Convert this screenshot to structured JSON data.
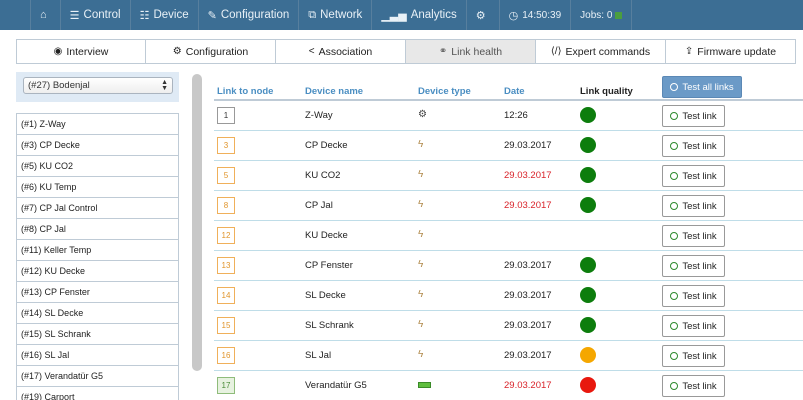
{
  "nav": {
    "items": [
      {
        "name": "nav-home",
        "icon": "home-icon",
        "glyph": "⌂",
        "label": ""
      },
      {
        "name": "nav-control",
        "icon": "sliders-icon",
        "glyph": "☰",
        "label": "Control"
      },
      {
        "name": "nav-device",
        "icon": "database-icon",
        "glyph": "☷",
        "label": "Device"
      },
      {
        "name": "nav-configuration",
        "icon": "wrench-icon",
        "glyph": "✎",
        "label": "Configuration"
      },
      {
        "name": "nav-network",
        "icon": "network-icon",
        "glyph": "⧉",
        "label": "Network"
      },
      {
        "name": "nav-analytics",
        "icon": "signal-icon",
        "glyph": "▁▃▅",
        "label": "Analytics"
      },
      {
        "name": "nav-settings",
        "icon": "gear-icon",
        "glyph": "⚙",
        "label": ""
      }
    ],
    "time": "14:50:39",
    "jobs_label": "Jobs: 0"
  },
  "tabs": [
    {
      "label": "Interview",
      "icon": "comment-icon",
      "glyph": "◉"
    },
    {
      "label": "Configuration",
      "icon": "gears-icon",
      "glyph": "⚙"
    },
    {
      "label": "Association",
      "icon": "share-icon",
      "glyph": "<"
    },
    {
      "label": "Link health",
      "icon": "link-icon",
      "glyph": "⚭"
    },
    {
      "label": "Expert commands",
      "icon": "code-icon",
      "glyph": "⟨/⟩"
    },
    {
      "label": "Firmware update",
      "icon": "upload-icon",
      "glyph": "⇪"
    }
  ],
  "active_tab": "Link health",
  "device_select": {
    "value": "(#27) Bodenjal"
  },
  "device_list": [
    "(#1) Z-Way",
    "(#3) CP Decke",
    "(#5) KU CO2",
    "(#6) KU Temp",
    "(#7) CP Jal Control",
    "(#8) CP Jal",
    "(#11) Keller Temp",
    "(#12) KU Decke",
    "(#13) CP Fenster",
    "(#14) SL Decke",
    "(#15) SL Schrank",
    "(#16) SL Jal",
    "(#17) Verandatür G5",
    "(#19) Carport"
  ],
  "table": {
    "headers": {
      "link": "Link to node",
      "name": "Device name",
      "type": "Device type",
      "date": "Date",
      "quality": "Link quality"
    },
    "test_all_label": "Test all links",
    "test_link_label": "Test link",
    "colors": {
      "green": "#0d7d0d",
      "orange": "#f5a700",
      "red": "#e8180e"
    },
    "rows": [
      {
        "node": "1",
        "node_style": "plain",
        "name": "Z-Way",
        "type": "gear-icon",
        "type_glyph": "⚙",
        "date": "12:26",
        "date_red": false,
        "quality": "green"
      },
      {
        "node": "3",
        "node_style": "orange",
        "name": "CP Decke",
        "type": "bolt-icon",
        "type_glyph": "ϟ",
        "date": "29.03.2017",
        "date_red": false,
        "quality": "green"
      },
      {
        "node": "5",
        "node_style": "orange",
        "name": "KU CO2",
        "type": "bolt-icon",
        "type_glyph": "ϟ",
        "date": "29.03.2017",
        "date_red": true,
        "quality": "green"
      },
      {
        "node": "8",
        "node_style": "orange",
        "name": "CP Jal",
        "type": "bolt-icon",
        "type_glyph": "ϟ",
        "date": "29.03.2017",
        "date_red": true,
        "quality": "green"
      },
      {
        "node": "12",
        "node_style": "orange",
        "name": "KU Decke",
        "type": "bolt-icon",
        "type_glyph": "ϟ",
        "date": "",
        "date_red": false,
        "quality": ""
      },
      {
        "node": "13",
        "node_style": "orange",
        "name": "CP Fenster",
        "type": "bolt-icon",
        "type_glyph": "ϟ",
        "date": "29.03.2017",
        "date_red": false,
        "quality": "green"
      },
      {
        "node": "14",
        "node_style": "orange",
        "name": "SL Decke",
        "type": "bolt-icon",
        "type_glyph": "ϟ",
        "date": "29.03.2017",
        "date_red": false,
        "quality": "green"
      },
      {
        "node": "15",
        "node_style": "orange",
        "name": "SL Schrank",
        "type": "bolt-icon",
        "type_glyph": "ϟ",
        "date": "29.03.2017",
        "date_red": false,
        "quality": "green"
      },
      {
        "node": "16",
        "node_style": "orange",
        "name": "SL Jal",
        "type": "bolt-icon",
        "type_glyph": "ϟ",
        "date": "29.03.2017",
        "date_red": false,
        "quality": "orange"
      },
      {
        "node": "17",
        "node_style": "green",
        "name": "Verandatür G5",
        "type": "battery-icon",
        "type_glyph": "",
        "date": "29.03.2017",
        "date_red": true,
        "quality": "red"
      }
    ]
  }
}
